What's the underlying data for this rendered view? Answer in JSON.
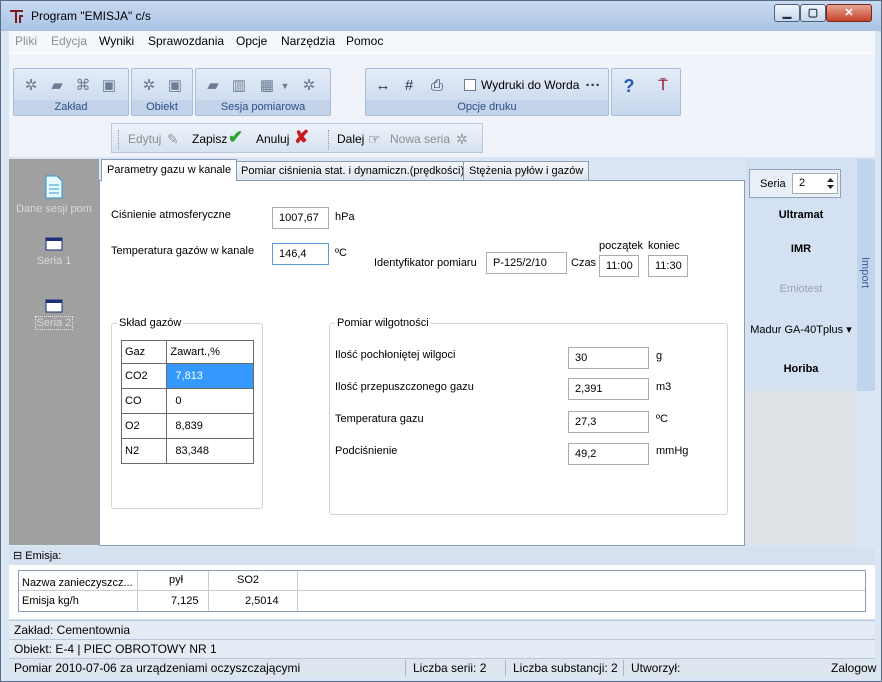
{
  "window": {
    "title": "Program \"EMISJA\" c/s",
    "min_label": "▁",
    "max_label": "▢",
    "close_label": "✕"
  },
  "menu": {
    "items": [
      {
        "label": "Pliki",
        "enabled": false
      },
      {
        "label": "Edycja",
        "enabled": false
      },
      {
        "label": "Wyniki",
        "enabled": true
      },
      {
        "label": "Sprawozdania",
        "enabled": true
      },
      {
        "label": "Opcje",
        "enabled": true
      },
      {
        "label": "Narzędzia",
        "enabled": true
      },
      {
        "label": "Pomoc",
        "enabled": true
      }
    ]
  },
  "ribbon": {
    "groups": [
      {
        "label": "Zakład"
      },
      {
        "label": "Obiekt"
      },
      {
        "label": "Sesja pomiarowa"
      },
      {
        "label": "Opcje druku"
      }
    ],
    "wydruki_label": "Wydruki do Worda",
    "more_label": "···",
    "help_label": "?"
  },
  "actions": {
    "edytuj": "Edytuj",
    "zapisz": "Zapisz",
    "anuluj": "Anuluj",
    "dalej": "Dalej",
    "nowa_seria": "Nowa seria"
  },
  "left_nav": {
    "items": [
      {
        "label": "Dane sesji pom",
        "selected": false
      },
      {
        "label": "Seria 1",
        "selected": false
      },
      {
        "label": "Seria 2",
        "selected": true
      }
    ]
  },
  "tabs": [
    {
      "label": "Parametry gazu w kanale",
      "active": true
    },
    {
      "label": "Pomiar ciśnienia stat. i dynamiczn.(prędkości)",
      "active": false
    },
    {
      "label": "Stężenia pyłów i gazów",
      "active": false
    }
  ],
  "form": {
    "cisnienie_label": "Ciśnienie atmosferyczne",
    "cisnienie_value": "1007,67",
    "cisnienie_unit": "hPa",
    "temperatura_label": "Temperatura gazów w kanale",
    "temperatura_value": "146,4",
    "temperatura_unit": "ºC",
    "identyfikator_label": "Identyfikator pomiaru",
    "identyfikator_value": "P-125/2/10",
    "czas_label": "Czas",
    "poczatek_label": "początek",
    "poczatek_value": "11:00",
    "koniec_label": "koniec",
    "koniec_value": "11:30"
  },
  "sklad": {
    "title": "Skład gazów",
    "headers": [
      "Gaz",
      "Zawart.,%"
    ],
    "rows": [
      {
        "gas": "CO2",
        "value": "7,813"
      },
      {
        "gas": "CO",
        "value": "0"
      },
      {
        "gas": "O2",
        "value": "8,839"
      },
      {
        "gas": "N2",
        "value": "83,348"
      }
    ]
  },
  "wilgotnosc": {
    "title": "Pomiar wilgotności",
    "rows": [
      {
        "label": "Ilość pochłoniętej wilgoci",
        "value": "30",
        "unit": "g"
      },
      {
        "label": "Ilość przepuszczonego gazu",
        "value": "2,391",
        "unit": "m3"
      },
      {
        "label": "Temperatura gazu",
        "value": "27,3",
        "unit": "ºC"
      },
      {
        "label": "Podciśnienie",
        "value": "49,2",
        "unit": "mmHg"
      }
    ]
  },
  "right_panel": {
    "seria_label": "Seria",
    "seria_value": "2",
    "items": [
      {
        "label": "Ultramat",
        "enabled": true
      },
      {
        "label": "IMR",
        "enabled": true
      },
      {
        "label": "Emiotest",
        "enabled": false
      },
      {
        "label": "Madur GA-40Tplus ▾",
        "enabled": true
      },
      {
        "label": "Horiba",
        "enabled": true
      }
    ],
    "import_label": "Import"
  },
  "emisja": {
    "header": "Emisja:",
    "collapse_symbol": "⊟",
    "col_headers": [
      "Nazwa zanieczyszcz...",
      "pył",
      "SO2"
    ],
    "row_label": "Emisja kg/h",
    "row_values": [
      "7,125",
      "2,5014"
    ]
  },
  "status": {
    "zaklad": "Zakład: Cementownia",
    "obiekt": "Obiekt: E-4 | PIEC OBROTOWY NR 1",
    "pomiar": "Pomiar 2010-07-06 za urządzeniami oczyszczającymi",
    "liczba_serii": "Liczba serii: 2",
    "liczba_substancji": "Liczba substancji: 2",
    "utworzyl": "Utworzył:",
    "zalogowany": "Zalogow"
  }
}
